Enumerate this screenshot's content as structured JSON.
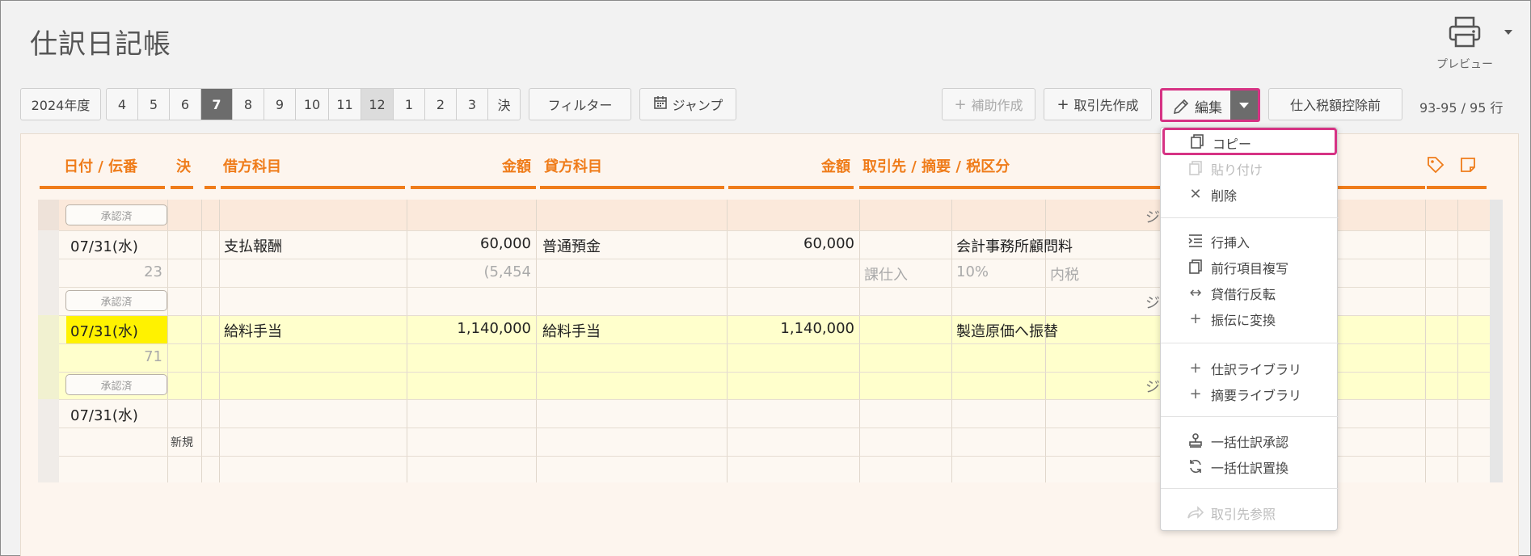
{
  "title": "仕訳日記帳",
  "preview_label": "プレビュー",
  "toolbar": {
    "fiscal_year": "2024年度",
    "months": [
      "4",
      "5",
      "6",
      "7",
      "8",
      "9",
      "10",
      "11",
      "12",
      "1",
      "2",
      "3",
      "決"
    ],
    "active_month": "7",
    "filter_label": "フィルター",
    "jump_label": "ジャンプ",
    "aux_create_label": "補助作成",
    "partner_create_label": "取引先作成",
    "edit_label": "編集",
    "tax_label": "仕入税額控除前",
    "row_count": "93-95 / 95 行"
  },
  "headers": {
    "date": "日付 / 伝番",
    "settle": "決",
    "debit_account": "借方科目",
    "debit_amount": "金額",
    "credit_account": "貸方科目",
    "credit_amount": "金額",
    "partner": "取引先 / 摘要 / 税区分"
  },
  "rows": {
    "r0_badge": "承認済",
    "r0_trail": "ジ",
    "r1_date": "07/31(水)",
    "r1_debit": "支払報酬",
    "r1_debit_amt": "60,000",
    "r1_credit": "普通預金",
    "r1_credit_amt": "60,000",
    "r1_memo": "会計事務所顧問料",
    "r1_no": "23",
    "r1_tax_amt": "(5,454",
    "r1_tax_kind": "課仕入",
    "r1_tax_rate": "10%",
    "r1_tax_incl": "内税",
    "r1_badge": "承認済",
    "r1_trail": "ジ",
    "r2_date": "07/31(水)",
    "r2_debit": "給料手当",
    "r2_debit_amt": "1,140,000",
    "r2_credit": "給料手当",
    "r2_credit_amt": "1,140,000",
    "r2_memo": "製造原価へ振替",
    "r2_no": "71",
    "r2_badge": "承認済",
    "r2_trail": "ジ",
    "r3_date": "07/31(水)",
    "r3_new": "新規"
  },
  "menu": {
    "copy": "コピー",
    "paste": "貼り付け",
    "delete": "削除",
    "insert_row": "行挿入",
    "copy_prev": "前行項目複写",
    "swap": "貸借行反転",
    "to_transfer": "振伝に変換",
    "journal_lib": "仕訳ライブラリ",
    "summary_lib": "摘要ライブラリ",
    "bulk_approve": "一括仕訳承認",
    "bulk_replace": "一括仕訳置換",
    "partner_ref": "取引先参照"
  },
  "colors": {
    "accent_orange": "#ef7c1a",
    "highlight_pink": "#d63384",
    "row_highlight": "#ffffcc",
    "date_highlight": "#fff200"
  }
}
